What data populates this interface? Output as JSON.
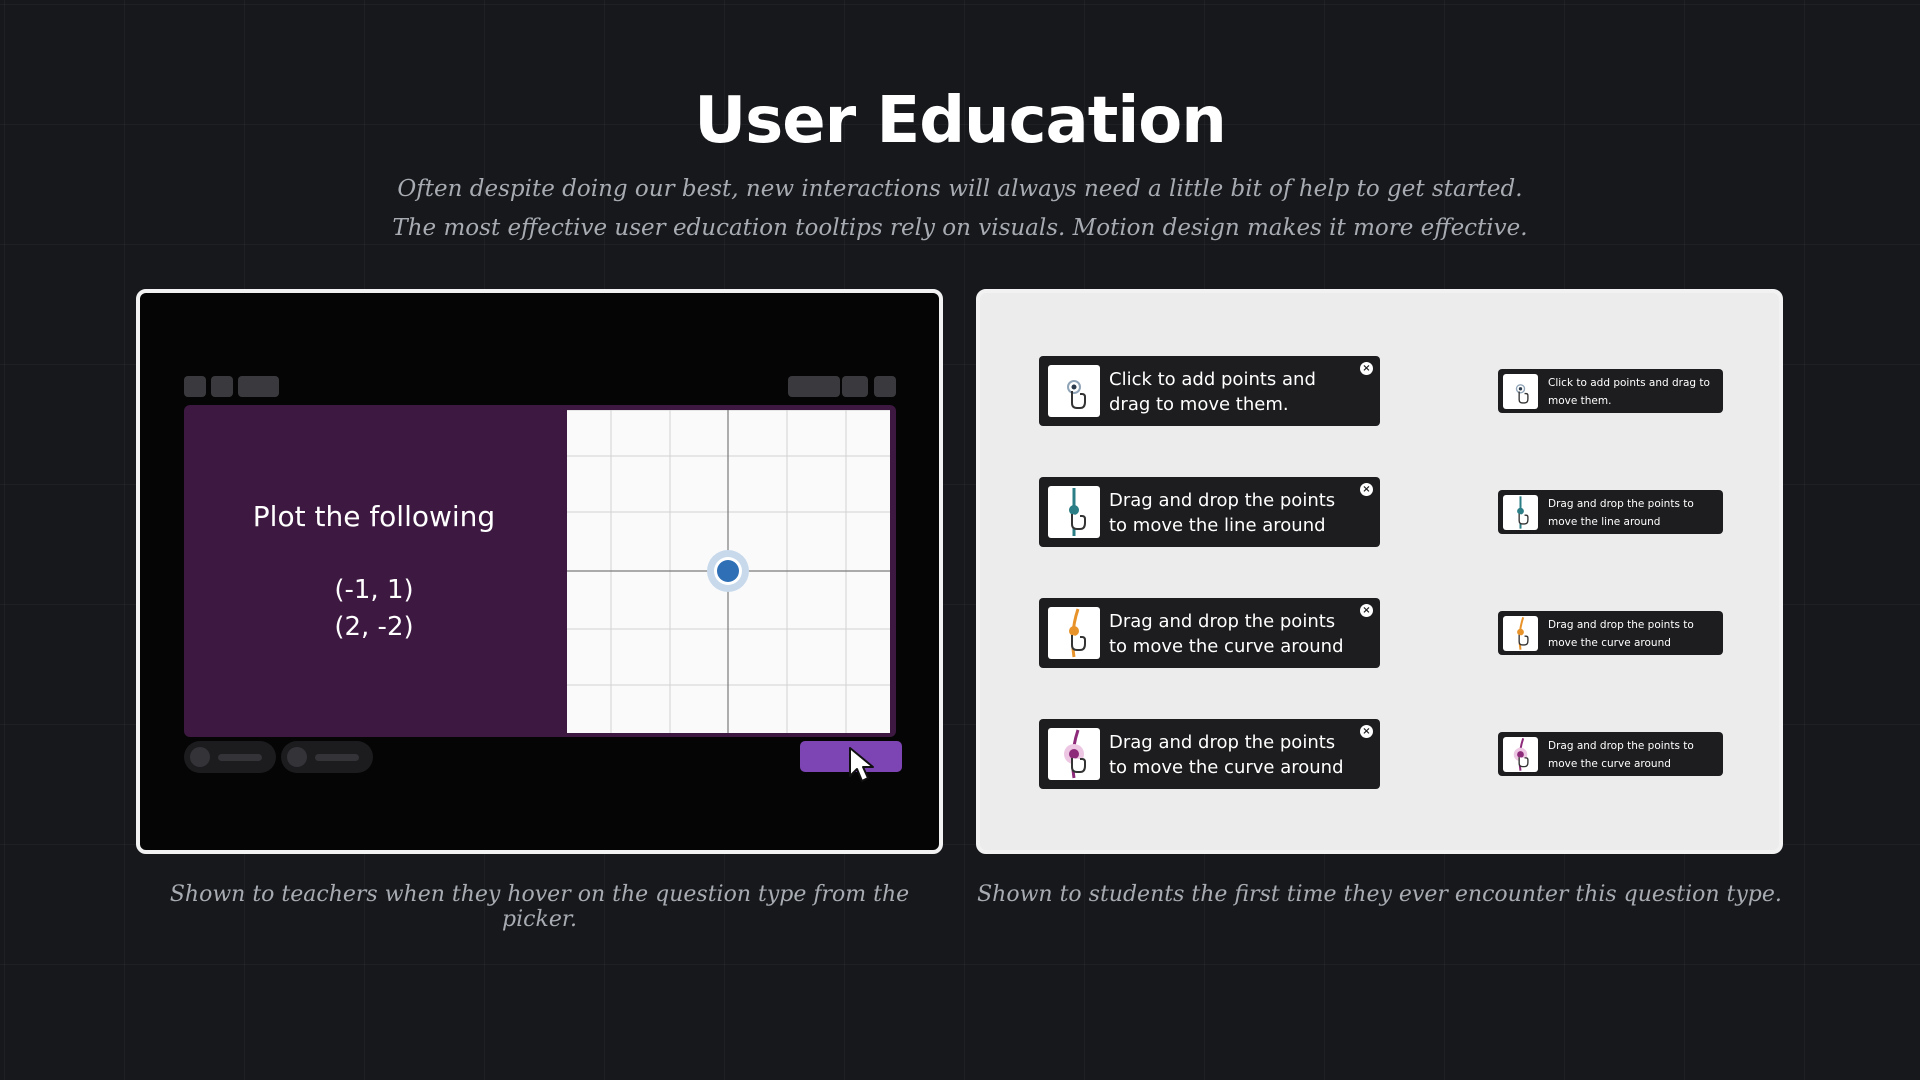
{
  "header": {
    "title": "User Education",
    "subtitle_line1": "Often despite doing our best, new interactions will always need a little bit of help to get started.",
    "subtitle_line2": "The most effective user education tooltips rely on visuals. Motion design makes it more effective."
  },
  "left_panel": {
    "question_title": "Plot the following",
    "points": [
      "(-1, 1)",
      "(2, -2)"
    ],
    "caption": "Shown to teachers when they hover on the question type from the picker."
  },
  "right_panel": {
    "caption": "Shown to students the first time they ever encounter this question type.",
    "tooltips": [
      {
        "line1": "Click to add points and",
        "line2": "drag to move them.",
        "small_line1": "Click to add points and drag to",
        "small_line2": "move them.",
        "icon": "point-tap-icon",
        "accent": "#90a4b8"
      },
      {
        "line1": "Drag and drop the points",
        "line2": "to move the line around",
        "small_line1": "Drag and drop the points to",
        "small_line2": "move the line around",
        "icon": "line-drag-icon",
        "accent": "#2b7d86"
      },
      {
        "line1": "Drag and drop the points",
        "line2": "to move the curve around",
        "small_line1": "Drag and drop the points to",
        "small_line2": "move the curve around",
        "icon": "curve-drag-icon",
        "accent": "#e8932a"
      },
      {
        "line1": "Drag and drop the points",
        "line2": "to move the curve around",
        "small_line1": "Drag and drop the points to",
        "small_line2": "move the curve around",
        "icon": "curve-drag-icon",
        "accent": "#8e2a7a"
      }
    ],
    "close_glyph": "×"
  },
  "colors": {
    "background": "#16181c",
    "slide": "#3d1841",
    "submit": "#7d45b4",
    "point": "#2f6fb5"
  }
}
